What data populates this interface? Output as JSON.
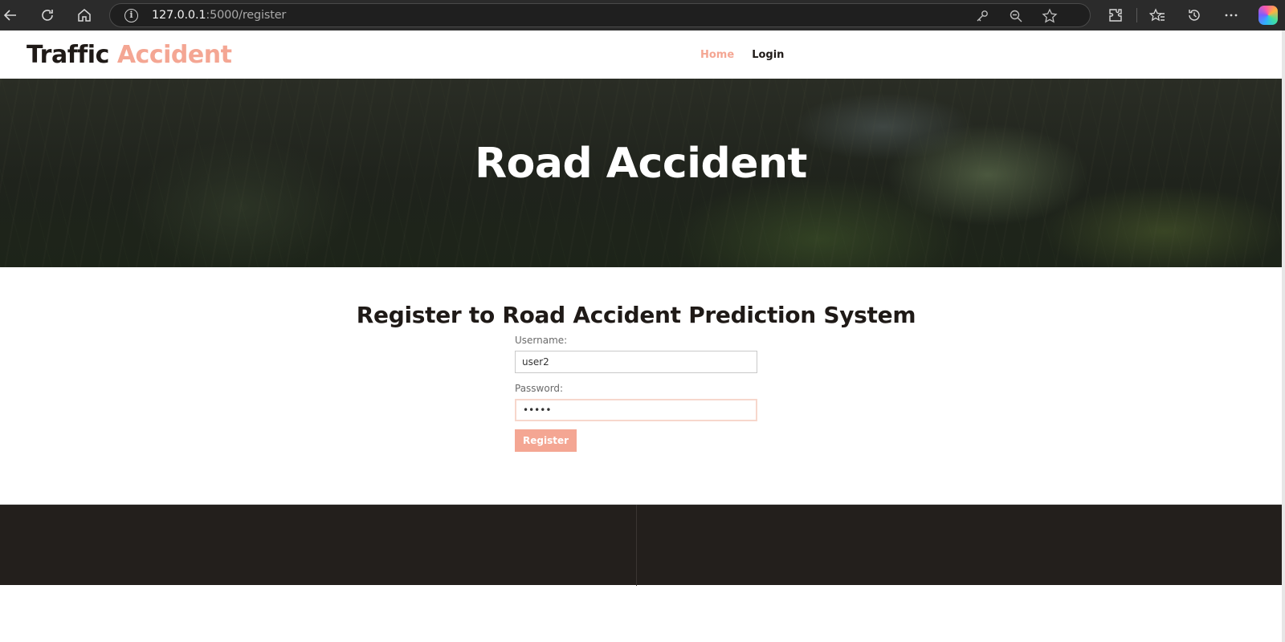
{
  "browser": {
    "url_host": "127.0.0.1",
    "url_path": ":5000/register"
  },
  "site": {
    "logo_main": "Traffic",
    "logo_accent": "Accident",
    "nav": {
      "home": "Home",
      "login": "Login"
    },
    "hero_title": "Road Accident"
  },
  "register": {
    "title": "Register to Road Accident Prediction System",
    "username_label": "Username:",
    "username_value": "user2",
    "password_label": "Password:",
    "password_value": "•••••",
    "button_label": "Register"
  },
  "colors": {
    "accent": "#f4a693",
    "dark": "#1f1a17",
    "footer": "#231f1c"
  }
}
